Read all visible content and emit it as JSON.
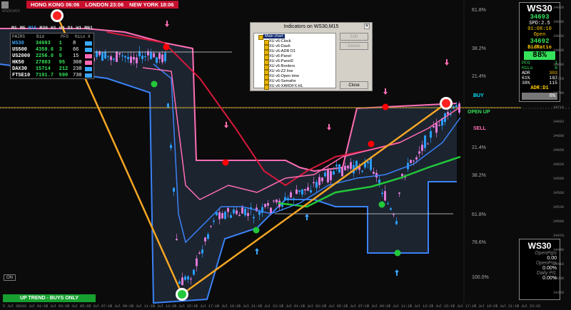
{
  "sessions": {
    "hong_kong": "HONG KONG 06:06",
    "london": "LONDON 23:06",
    "new_york": "NEW YORK 18:06"
  },
  "chart_label": "WS30,M15",
  "timeframes": [
    "M1",
    "M5",
    "M15",
    "M30",
    "H1",
    "H4",
    "D1",
    "W1",
    "MN1"
  ],
  "timeframe_selected": "M15",
  "pairs_table": {
    "headers": [
      "PAIRS",
      "Bid",
      "PFO",
      "HiLo",
      "X"
    ],
    "rows": [
      {
        "pair": "WS30",
        "bid": "34693",
        "pfo": "1",
        "hilo": "8",
        "color": "#3ba7ff"
      },
      {
        "pair": "US500",
        "bid": "4359.6",
        "pfo": "3",
        "hilo": "66",
        "color": "#3ba7ff"
      },
      {
        "pair": "US2000",
        "bid": "2256.0",
        "pfo": "5",
        "hilo": "15",
        "color": "#ff69b4"
      },
      {
        "pair": "HK50",
        "bid": "27803",
        "pfo": "95",
        "hilo": "308",
        "color": "#ff69b4"
      },
      {
        "pair": "DAX30",
        "bid": "15714",
        "pfo": "212",
        "hilo": "238",
        "color": "#3ba7ff"
      },
      {
        "pair": "FTSE10",
        "bid": "7191.7",
        "pfo": "590",
        "hilo": "730",
        "color": "#3ba7ff"
      }
    ]
  },
  "dialog": {
    "title": "Indicators on WS30,M15",
    "root": "Main chart",
    "items": [
      "XU v6-Clock",
      "XU v6-Dash",
      "XU v6-ADR D1",
      "XU v6-Panel",
      "XU v6-Panel2",
      "XU v6-Borders",
      "XU v6-ZZ line",
      "XU v6-Open time",
      "XU v6-Semafor",
      "XU v6-XARDFX.HL"
    ],
    "edit_label": "Edit",
    "delete_label": "Delete",
    "close_label": "Close"
  },
  "info_panel": {
    "symbol": "WS30",
    "bid": "34693",
    "spread": "SPD:2.5",
    "countdown": "01:08:10",
    "open_label": "Open",
    "open_value": "34692",
    "bidratio_label": "BidRatio",
    "bidratio_value": "88%",
    "pfo_label": "PFO",
    "pfo_value": "1",
    "hilo_label": "HiLo",
    "hilo_value": "8",
    "adr_label": "ADR",
    "adr_value": "303",
    "pct1": "61%",
    "num1": "187",
    "pct2": "38%",
    "num2": "115",
    "adr_d1": "ADR:D1",
    "zero_pct": "0%"
  },
  "bottom_panel": {
    "symbol": "WS30",
    "open_pips_label": "OpenPips",
    "open_pips_value": "0.00",
    "open_pos_label": "OpenPos",
    "open_pos_value": "0.00%",
    "daily_pl_label": "Daily P/L",
    "daily_pl_value": "0.00%"
  },
  "labels": {
    "buy": "BUY",
    "open_up": "OPEN UP",
    "sell": "SELL",
    "trend": "UP TREND - BUYS ONLY",
    "on": "ON"
  },
  "fib_labels": [
    "61.8%",
    "38.2%",
    "21.4%",
    "21.4%",
    "38.2%",
    "61.8%",
    "78.6%",
    "100.0%"
  ],
  "price_scale": [
    "34920",
    "34890",
    "34860",
    "34830",
    "34800",
    "34770",
    "34740",
    "34710",
    "34693",
    "34680",
    "34650",
    "34620",
    "34590",
    "34560",
    "34530",
    "34500",
    "34470",
    "34440",
    "34410",
    "34380",
    "34350"
  ],
  "time_scale": [
    "5 Jul 2021",
    "6 Jul 01:15",
    "6 Jul 03:15",
    "6 Jul 05:15",
    "6 Jul 07:15",
    "6 Jul 09:15",
    "6 Jul 11:15",
    "6 Jul 13:15",
    "6 Jul 15:15",
    "6 Jul 17:15",
    "6 Jul 19:15",
    "6 Jul 21:15",
    "6 Jul 23:15",
    "7 Jul 01:15",
    "7 Jul 03:15",
    "7 Jul 05:15",
    "7 Jul 07:15",
    "7 Jul 09:15",
    "7 Jul 11:15",
    "7 Jul 13:15",
    "7 Jul 15:15",
    "7 Jul 17:15",
    "7 Jul 19:15",
    "7 Jul 21:15",
    "7 Jul 23:15"
  ],
  "colors": {
    "bull": "#2a9dff",
    "bear": "#e07ad8",
    "upper_band": "#ff6eb4",
    "lower_band": "#3b82f6",
    "ma_red": "#d9183b",
    "ma_green": "#22c83a",
    "zigzag": "#f5a623"
  }
}
